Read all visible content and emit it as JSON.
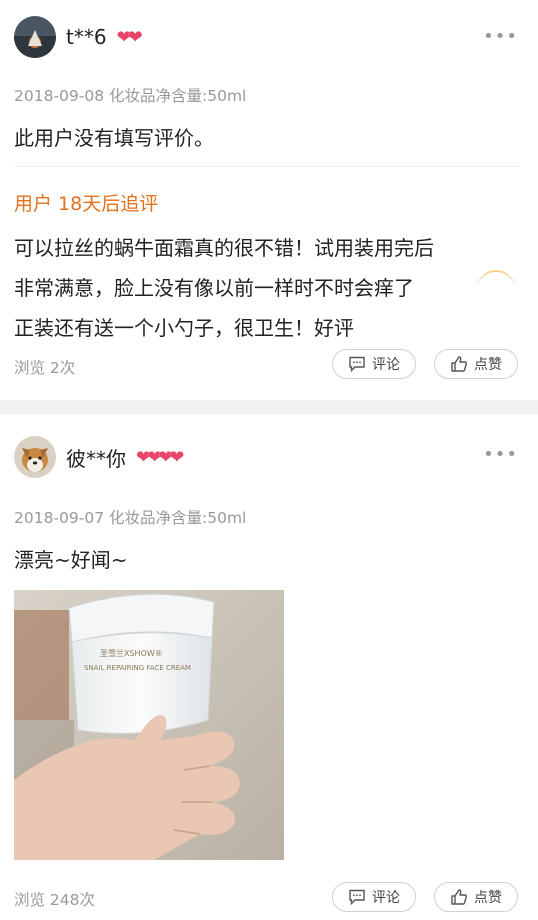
{
  "reviews": [
    {
      "username": "t**6",
      "badges": [
        "heart-badge",
        "heart-badge"
      ],
      "meta": "2018-09-08 化妆品净含量:50ml",
      "text": "此用户没有填写评价。",
      "followup": {
        "label": "用户 18天后追评",
        "lines": [
          "可以拉丝的蜗牛面霜真的很不错！试用装用完后",
          "非常满意，脸上没有像以前一样时不时会痒了",
          "正装还有送一个小勺子，很卫生！好评"
        ]
      },
      "views": "浏览 2次",
      "comment_label": "评论",
      "like_label": "点赞"
    },
    {
      "username": "彼**你",
      "badges": [
        "heart-badge",
        "heart-badge",
        "heart-badge",
        "heart-badge"
      ],
      "meta": "2018-09-07 化妆品净含量:50ml",
      "text": "漂亮~好闻~",
      "photo": {
        "brand_text": "圣雪兰XSHOW",
        "product_text": "SNAIL REPAIRING FACE CREAM"
      },
      "views": "浏览 248次",
      "comment_label": "评论",
      "like_label": "点赞"
    }
  ],
  "icons": {
    "more": "more-dots-icon",
    "comment": "comment-bubble-icon",
    "like": "thumbs-up-icon"
  },
  "colors": {
    "followup": "#e5711e",
    "meta": "#999999",
    "badge": "#e8456a",
    "separator": "#f2f2f2"
  }
}
